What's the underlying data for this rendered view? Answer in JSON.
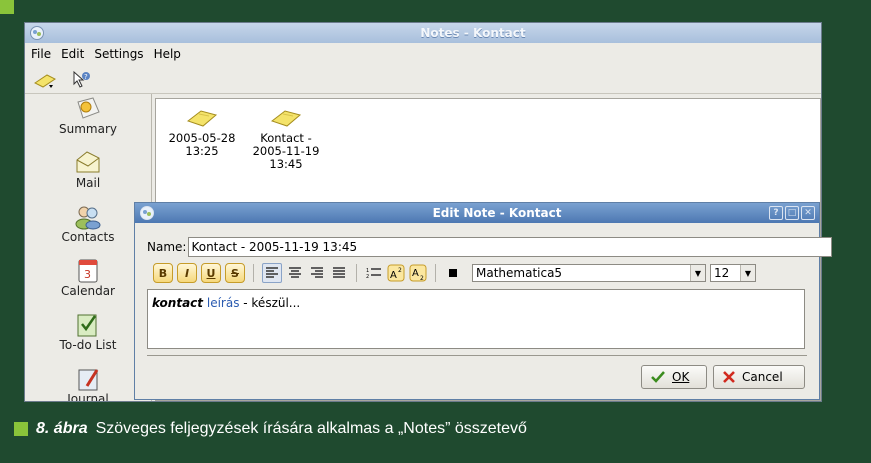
{
  "window": {
    "title": "Notes - Kontact"
  },
  "menu": [
    {
      "label": "File"
    },
    {
      "label": "Edit"
    },
    {
      "label": "Settings"
    },
    {
      "label": "Help"
    }
  ],
  "sidebar": {
    "items": [
      {
        "label": "Summary",
        "icon": "summary-icon"
      },
      {
        "label": "Mail",
        "icon": "mail-icon"
      },
      {
        "label": "Contacts",
        "icon": "contacts-icon"
      },
      {
        "label": "Calendar",
        "icon": "calendar-icon"
      },
      {
        "label": "To-do List",
        "icon": "todo-icon"
      },
      {
        "label": "Journal",
        "icon": "journal-icon"
      }
    ]
  },
  "notes": [
    {
      "line1": "2005-05-28",
      "line2": "13:25",
      "line3": ""
    },
    {
      "line1": "Kontact -",
      "line2": "2005-11-19",
      "line3": "13:45"
    }
  ],
  "dialog": {
    "title": "Edit Note - Kontact",
    "name_label": "Name:",
    "name_value": "Kontact - 2005-11-19 13:45",
    "font": "Mathematica5",
    "font_size": "12",
    "body_bold": "kontact",
    "body_blue": "leírás",
    "body_rest": " - készül...",
    "ok_label": "OK",
    "cancel_label": "Cancel",
    "format_buttons": [
      "B",
      "I",
      "U",
      "S"
    ]
  },
  "caption": {
    "number": "8. ábra",
    "text": "Szöveges feljegyzések írására alkalmas a „Notes” összetevő"
  },
  "colors": {
    "page_bg": "#1f4a2f",
    "accent_green": "#8ac43a",
    "title_blue": "#4d78b2"
  }
}
